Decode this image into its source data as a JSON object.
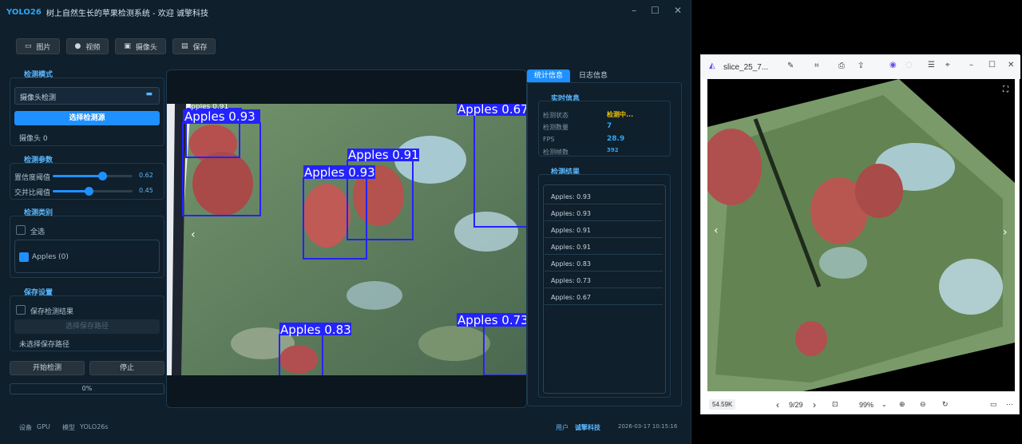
{
  "window": {
    "logo": "YOLO26",
    "title": "树上自然生长的苹果检测系统 - 欢迎 诚擎科技"
  },
  "toolbar": {
    "image": "图片",
    "video": "视频",
    "camera": "摄像头",
    "save": "保存"
  },
  "detect_mode": {
    "title": "检测模式",
    "select_value": "摄像头检测",
    "select_btn": "选择检测源",
    "camera_label": "摄像头 0"
  },
  "params": {
    "title": "检测参数",
    "conf_label": "置信度阈值",
    "conf_value": "0.62",
    "conf": 0.62,
    "iou_label": "交并比阈值",
    "iou_value": "0.45",
    "iou": 0.45
  },
  "classes": {
    "title": "检测类别",
    "all_label": "全选",
    "item_label": "Apples (0)"
  },
  "save_settings": {
    "title": "保存设置",
    "save_label": "保存检测结果",
    "choose_path": "选择保存路径",
    "no_path": "未选择保存路径"
  },
  "actions": {
    "start": "开始检测",
    "stop": "停止",
    "progress": "0%"
  },
  "tabs": {
    "stats": "统计信息",
    "log": "日志信息"
  },
  "realtime": {
    "title": "实时信息",
    "status_label": "检测状态",
    "status_value": "检测中...",
    "count_label": "检测数量",
    "count_value": "7",
    "fps_label": "FPS",
    "fps_value": "28.9",
    "frames_label": "检测帧数",
    "frames_value": "392"
  },
  "results": {
    "title": "检测结果",
    "items": [
      "Apples: 0.93",
      "Apples: 0.93",
      "Apples: 0.91",
      "Apples: 0.91",
      "Apples: 0.83",
      "Apples: 0.73",
      "Apples: 0.67"
    ]
  },
  "detections": [
    {
      "label": "Apples 0.93"
    },
    {
      "label": "Apples 0.91"
    },
    {
      "label": "Apples 0.93"
    },
    {
      "label": "Apples 0.67"
    },
    {
      "label": "Apples 0.83"
    },
    {
      "label": "Apples 0.73"
    },
    {
      "label": "Apples 0.91"
    }
  ],
  "status": {
    "device_label": "设备",
    "device_value": "GPU",
    "model_label": "模型",
    "model_value": "YOLO26s",
    "user_label": "用户",
    "user_value": "诚擎科技",
    "timestamp": "2026-03-17 10:15:16"
  },
  "viewer": {
    "filename": "slice_25_7...",
    "size": "54.59K",
    "page": "9/29",
    "zoom": "99%"
  },
  "colors": {
    "accent": "#1e90ff",
    "box": "#2323ff",
    "bg": "#0f1f2b"
  }
}
